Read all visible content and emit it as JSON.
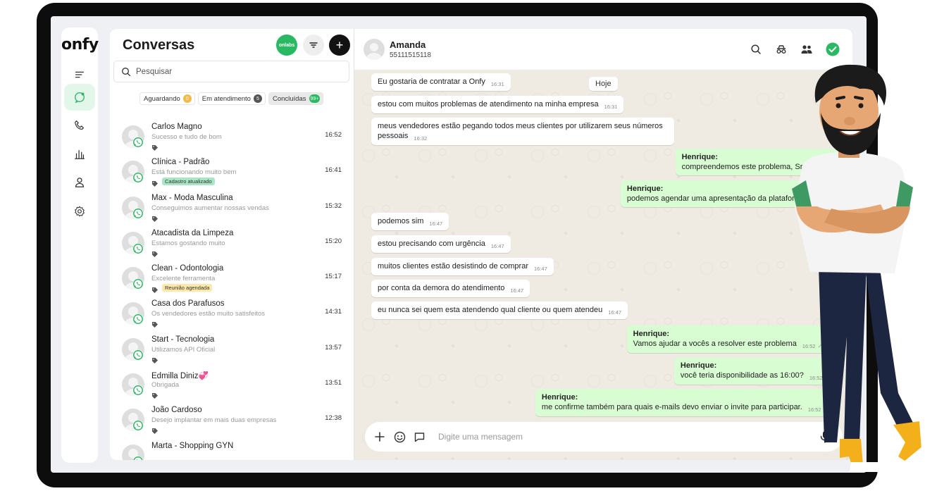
{
  "brand": {
    "logo": "onfy"
  },
  "rail": {
    "items": [
      "menu-icon",
      "chat-icon",
      "phone-icon",
      "chart-icon",
      "user-icon",
      "settings-icon"
    ],
    "active": "chat-icon"
  },
  "conversations": {
    "title": "Conversas",
    "onlabs_label": "onlabs",
    "new_label": "+",
    "search_placeholder": "Pesquisar",
    "filters": [
      {
        "label": "Aguardando",
        "count": "0",
        "color": "#f5b945"
      },
      {
        "label": "Em atendimento",
        "count": "5",
        "color": "#555555"
      },
      {
        "label": "Concluídas",
        "count": "99+",
        "color": "#29b962"
      }
    ],
    "items": [
      {
        "name": "Carlos Magno",
        "preview": "Sucesso e tudo de bom",
        "time": "16:52",
        "tag": "",
        "tag_color": ""
      },
      {
        "name": "Clínica - Padrão",
        "preview": "Está funcionando muito bem",
        "time": "16:41",
        "tag": "Cadastro atualizado",
        "tag_color": "#a8e6c4"
      },
      {
        "name": "Max - Moda Masculina",
        "preview": "Conseguimos aumentar nossas vendas",
        "time": "15:32",
        "tag": "",
        "tag_color": ""
      },
      {
        "name": "Atacadista da Limpeza",
        "preview": "Estamos gostando muito",
        "time": "15:20",
        "tag": "",
        "tag_color": ""
      },
      {
        "name": "Clean - Odontologia",
        "preview": "Excelente ferramenta",
        "time": "15:17",
        "tag": "Reunião agendada",
        "tag_color": "#fce9a8"
      },
      {
        "name": "Casa dos Parafusos",
        "preview": "Os vendedores estão muito satisfeitos",
        "time": "14:31",
        "tag": "",
        "tag_color": ""
      },
      {
        "name": "Start - Tecnologia",
        "preview": "Utilizamos API Oficial",
        "time": "13:57",
        "tag": "",
        "tag_color": ""
      },
      {
        "name": "Edmilla Diniz💞",
        "preview": "Obrigada",
        "time": "13:51",
        "tag": "",
        "tag_color": ""
      },
      {
        "name": "João Cardoso",
        "preview": "Desejo implantar em mais duas empresas",
        "time": "12:38",
        "tag": "",
        "tag_color": ""
      },
      {
        "name": "Marta - Shopping GYN",
        "preview": "",
        "time": "",
        "tag": "",
        "tag_color": ""
      }
    ]
  },
  "chat": {
    "contact_name": "Amanda",
    "contact_phone": "55111515118",
    "day_label": "Hoje",
    "messages": [
      {
        "dir": "in",
        "sender": "",
        "text": "Eu gostaria de contratar a Onfy",
        "time": "16:31"
      },
      {
        "dir": "in",
        "sender": "",
        "text": "estou com muitos problemas de atendimento na minha empresa",
        "time": "16:31"
      },
      {
        "dir": "in",
        "sender": "",
        "text": "meus vendedores estão pegando todos meus clientes por utilizarem seus números pessoais",
        "time": "16:32"
      },
      {
        "dir": "out",
        "sender": "Henrique",
        "text": "compreendemos este problema, Sra. Amanda",
        "time": ""
      },
      {
        "dir": "out",
        "sender": "Henrique",
        "text": "podemos agendar uma apresentação da plataforma para hoje",
        "time": ""
      },
      {
        "dir": "in",
        "sender": "",
        "text": "podemos sim",
        "time": "16:47"
      },
      {
        "dir": "in",
        "sender": "",
        "text": "estou precisando com urgência",
        "time": "16:47"
      },
      {
        "dir": "in",
        "sender": "",
        "text": "muitos clientes estão desistindo de comprar",
        "time": "16:47"
      },
      {
        "dir": "in",
        "sender": "",
        "text": "por conta da demora do atendimento",
        "time": "16:47"
      },
      {
        "dir": "in",
        "sender": "",
        "text": "eu nunca sei quem esta atendendo qual cliente ou quem atendeu",
        "time": "16:47"
      },
      {
        "dir": "out",
        "sender": "Henrique",
        "text": "Vamos ajudar a vocês a resolver este problema",
        "time": "16:52"
      },
      {
        "dir": "out",
        "sender": "Henrique",
        "text": "você teria disponibilidade as 16:00?",
        "time": "16:52"
      },
      {
        "dir": "out",
        "sender": "Henrique",
        "text": "me confirme também para quais e-mails devo enviar o invite para participar.",
        "time": "16:52"
      }
    ],
    "compose_placeholder": "Digite uma mensagem"
  },
  "colors": {
    "accent": "#29b962",
    "chat_bg": "#efeae2",
    "out_bubble": "#d9fdd3"
  }
}
